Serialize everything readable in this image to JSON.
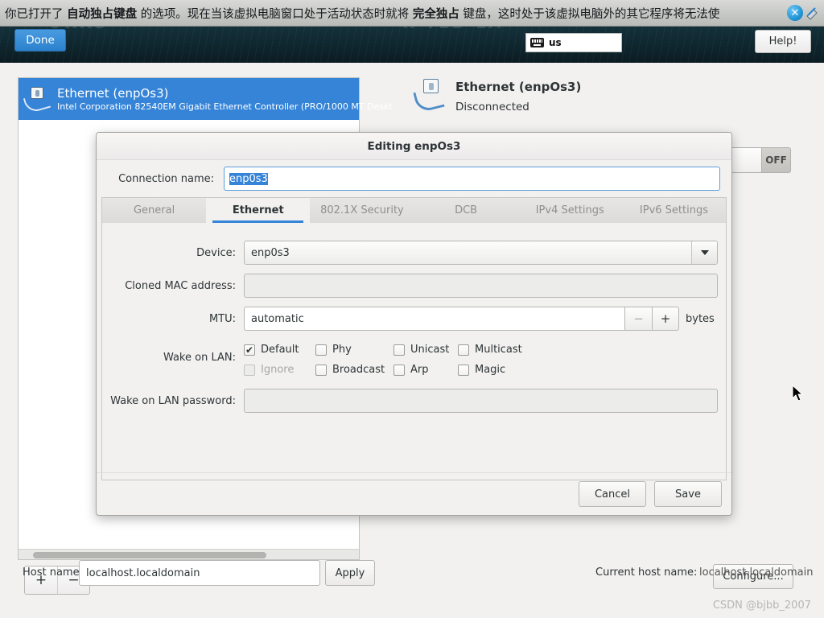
{
  "notification": {
    "text_part1": "你已打开了 ",
    "text_bold1": "自动独占键盘",
    "text_part2": " 的选项。现在当该虚拟电脑窗口处于活动状态时就将 ",
    "text_bold2": "完全独占",
    "text_part3": " 键盘，这时处于该虚拟电脑外的其它程序将无法使",
    "close_icon": "close-icon",
    "expand_icon": "expand-icon"
  },
  "topbar": {
    "done_label": "Done",
    "help_label": "Help!",
    "keyboard_layout": "us",
    "keyboard_icon": "keyboard-icon"
  },
  "device_list": {
    "items": [
      {
        "title": "Ethernet (enpOs3)",
        "subtitle": "Intel Corporation 82540EM Gigabit Ethernet Controller (PRO/1000 MT Deskt",
        "icon": "ethernet-icon",
        "selected": true
      }
    ],
    "add_label": "+",
    "remove_label": "−"
  },
  "detail": {
    "name": "Ethernet (enpOs3)",
    "status": "Disconnected",
    "icon": "ethernet-icon",
    "toggle_state": "OFF",
    "configure_label": "Configure..."
  },
  "hostname": {
    "label": "Host name:",
    "value": "localhost.localdomain",
    "placeholder": "",
    "apply_label": "Apply",
    "current_label": "Current host name:",
    "current_value": "localhost.localdomain"
  },
  "dialog": {
    "title": "Editing enpOs3",
    "connection_name_label": "Connection name:",
    "connection_name_value": "enp0s3",
    "tabs": [
      {
        "label": "General",
        "active": false
      },
      {
        "label": "Ethernet",
        "active": true
      },
      {
        "label": "802.1X Security",
        "active": false
      },
      {
        "label": "DCB",
        "active": false
      },
      {
        "label": "IPv4 Settings",
        "active": false
      },
      {
        "label": "IPv6 Settings",
        "active": false
      }
    ],
    "fields": {
      "device_label": "Device:",
      "device_value": "enp0s3",
      "cloned_mac_label": "Cloned MAC address:",
      "cloned_mac_value": "",
      "mtu_label": "MTU:",
      "mtu_value": "automatic",
      "mtu_minus": "−",
      "mtu_plus": "+",
      "mtu_unit": "bytes",
      "wol_label": "Wake on LAN:",
      "wol_password_label": "Wake on LAN password:",
      "wol_password_value": ""
    },
    "wake_on_lan": [
      {
        "label": "Default",
        "checked": true,
        "disabled": false
      },
      {
        "label": "Phy",
        "checked": false,
        "disabled": false
      },
      {
        "label": "Unicast",
        "checked": false,
        "disabled": false
      },
      {
        "label": "Multicast",
        "checked": false,
        "disabled": false
      },
      {
        "label": "Ignore",
        "checked": false,
        "disabled": true
      },
      {
        "label": "Broadcast",
        "checked": false,
        "disabled": false
      },
      {
        "label": "Arp",
        "checked": false,
        "disabled": false
      },
      {
        "label": "Magic",
        "checked": false,
        "disabled": false
      }
    ],
    "cancel_label": "Cancel",
    "save_label": "Save"
  },
  "watermark": "CSDN @bjbb_2007",
  "colors": {
    "accent": "#3584d8",
    "bg": "#f2f1f0",
    "dialog_bg": "#f2f1f0"
  }
}
